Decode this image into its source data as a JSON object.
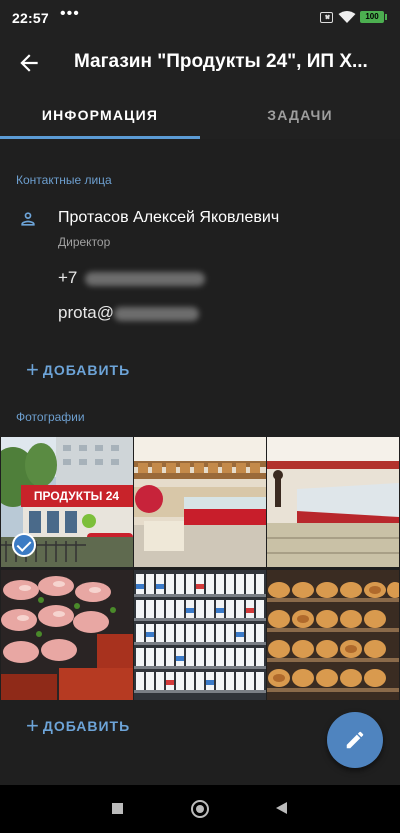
{
  "status_bar": {
    "time": "22:57",
    "menu_dots": "•••",
    "battery": "100"
  },
  "app_bar": {
    "title": "Магазин \"Продукты 24\", ИП Х..."
  },
  "tabs": [
    {
      "label": "ИНФОРМАЦИЯ",
      "active": true
    },
    {
      "label": "ЗАДАЧИ",
      "active": false
    }
  ],
  "contacts": {
    "section_label": "Контактные лица",
    "person": {
      "name": "Протасов Алексей Яковлевич",
      "role": "Директор",
      "phone_prefix": "+7",
      "email_prefix": "prota@"
    },
    "add_label": "ДОБАВИТЬ"
  },
  "photos": {
    "section_label": "Фотографии",
    "items": [
      {
        "subject": "store-exterior",
        "selected": true,
        "sign": "ПРОДУКТЫ 24"
      },
      {
        "subject": "grocery-counter",
        "selected": false
      },
      {
        "subject": "deli-counter",
        "selected": false
      },
      {
        "subject": "meat-display",
        "selected": false
      },
      {
        "subject": "dairy-shelves",
        "selected": false
      },
      {
        "subject": "bread-shelves",
        "selected": false
      }
    ],
    "add_label": "ДОБАВИТЬ"
  },
  "fab": {
    "icon": "pencil-icon"
  },
  "colors": {
    "accent": "#5b9bd5",
    "background": "#1f1f1f",
    "appbar": "#212121",
    "fab": "#4f84bf"
  }
}
